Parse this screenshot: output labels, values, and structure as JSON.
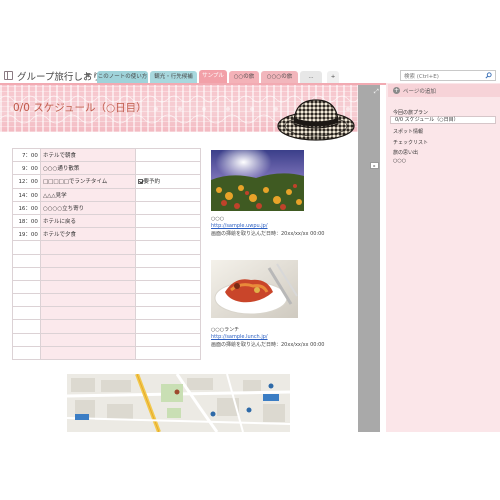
{
  "notebook": {
    "title": "グループ旅行しおり"
  },
  "tabs": [
    {
      "label": "このノートの使い方",
      "color": "#9fd3da"
    },
    {
      "label": "観光・行先候補",
      "color": "#a8d8de"
    },
    {
      "label": "サンプル",
      "color": "#f2a0a8",
      "active": true
    },
    {
      "label": "○○の旅",
      "color": "#f4b2b8"
    },
    {
      "label": "○○○の旅",
      "color": "#f2b6bc"
    },
    {
      "label": "...",
      "color": "#e7e7e7"
    },
    {
      "label": "+",
      "color": "#f0f0f0"
    }
  ],
  "search": {
    "placeholder": "検索 (Ctrl+E)"
  },
  "page": {
    "title": "0/0 スケジュール（○日目）"
  },
  "schedule": [
    {
      "time": "7：00",
      "activity": "ホテルで朝食",
      "note": ""
    },
    {
      "time": "9：00",
      "activity": "○○○通り散策",
      "note": ""
    },
    {
      "time": "12：00",
      "activity": "□□□□□でランチタイム",
      "note": "要予約",
      "checked": true
    },
    {
      "time": "14：00",
      "activity": "△△△見学",
      "note": ""
    },
    {
      "time": "16：00",
      "activity": "○○○○立ち寄り",
      "note": ""
    },
    {
      "time": "18：00",
      "activity": "ホテルに戻る",
      "note": ""
    },
    {
      "time": "19：00",
      "activity": "ホテルで夕食",
      "note": ""
    },
    {
      "time": "",
      "activity": "",
      "note": ""
    },
    {
      "time": "",
      "activity": "",
      "note": ""
    },
    {
      "time": "",
      "activity": "",
      "note": ""
    },
    {
      "time": "",
      "activity": "",
      "note": ""
    },
    {
      "time": "",
      "activity": "",
      "note": ""
    },
    {
      "time": "",
      "activity": "",
      "note": ""
    },
    {
      "time": "",
      "activity": "",
      "note": ""
    },
    {
      "time": "",
      "activity": "",
      "note": ""
    },
    {
      "time": "",
      "activity": "",
      "note": ""
    }
  ],
  "photos": [
    {
      "caption": "○○○",
      "link": "http://sample.uwpu.jp/",
      "source": "画面の挿絵を取り込んだ日時：20xx/xx/xx 00:00"
    },
    {
      "caption": "○○○ランチ",
      "link": "http://sample.lunch.jp/",
      "source": "画面の挿絵を取り込んだ日時：20xx/xx/xx 00:00"
    }
  ],
  "pages_panel": {
    "add_label": "ページの追加",
    "items": [
      {
        "label": "今回の旅プラン",
        "level": 0
      },
      {
        "label": "0/0 スケジュール（○日目）",
        "level": 1,
        "selected": true
      },
      {
        "label": "スポット情報",
        "level": 0
      },
      {
        "label": "チェックリスト",
        "level": 0
      },
      {
        "label": "旅の思い出",
        "level": 0
      },
      {
        "label": "○○○",
        "level": 0
      }
    ]
  },
  "colors": {
    "accent": "#f2a0a8",
    "header_band": "#f6c8ce",
    "pages_panel": "#fbe6e9",
    "title_text": "#c05a4a",
    "link": "#2b5fc2"
  }
}
